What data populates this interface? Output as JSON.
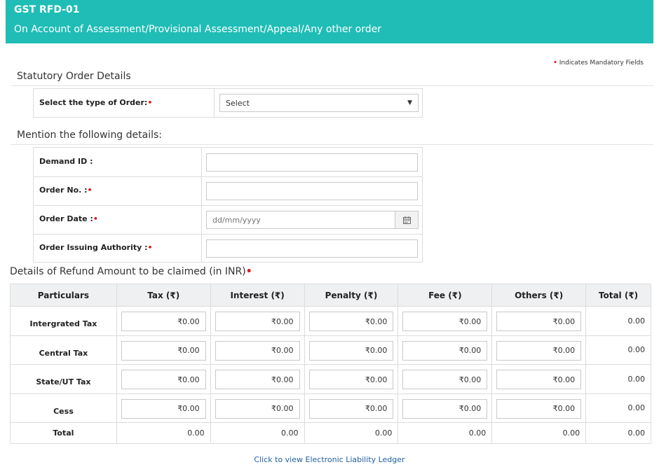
{
  "header": {
    "form_id": "GST RFD-01",
    "subtitle": "On Account of Assessment/Provisional Assessment/Appeal/Any other order"
  },
  "mandatory_note": "Indicates Mandatory Fields",
  "mandatory_marker": "•",
  "statutory": {
    "title": "Statutory Order Details",
    "order_type_label": "Select the type of Order:",
    "order_type_value": "Select"
  },
  "details": {
    "title": "Mention the following details:",
    "demand_id_label": "Demand ID :",
    "order_no_label": "Order No. :",
    "order_date_label": "Order Date :",
    "order_date_placeholder": "dd/mm/yyyy",
    "authority_label": "Order Issuing Authority :"
  },
  "refund": {
    "title": "Details of Refund Amount to be claimed (in INR)",
    "columns": [
      "Particulars",
      "Tax (₹)",
      "Interest (₹)",
      "Penalty (₹)",
      "Fee (₹)",
      "Others (₹)",
      "Total (₹)"
    ],
    "rows": [
      {
        "label": "Intergrated Tax",
        "values": [
          "₹0.00",
          "₹0.00",
          "₹0.00",
          "₹0.00",
          "₹0.00"
        ],
        "total": "0.00"
      },
      {
        "label": "Central Tax",
        "values": [
          "₹0.00",
          "₹0.00",
          "₹0.00",
          "₹0.00",
          "₹0.00"
        ],
        "total": "0.00"
      },
      {
        "label": "State/UT Tax",
        "values": [
          "₹0.00",
          "₹0.00",
          "₹0.00",
          "₹0.00",
          "₹0.00"
        ],
        "total": "0.00"
      },
      {
        "label": "Cess",
        "values": [
          "₹0.00",
          "₹0.00",
          "₹0.00",
          "₹0.00",
          "₹0.00"
        ],
        "total": "0.00"
      }
    ],
    "total_row": {
      "label": "Total",
      "values": [
        "0.00",
        "0.00",
        "0.00",
        "0.00",
        "0.00",
        "0.00"
      ]
    }
  },
  "ledger_link": "Click to view Electronic Liability Ledger",
  "icons": {
    "calendar": "calendar-icon",
    "dropdown": "chevron-down-icon"
  },
  "colors": {
    "header_bg": "#1fbdb5",
    "mandatory": "#e0151c",
    "link": "#1f5f9f"
  }
}
